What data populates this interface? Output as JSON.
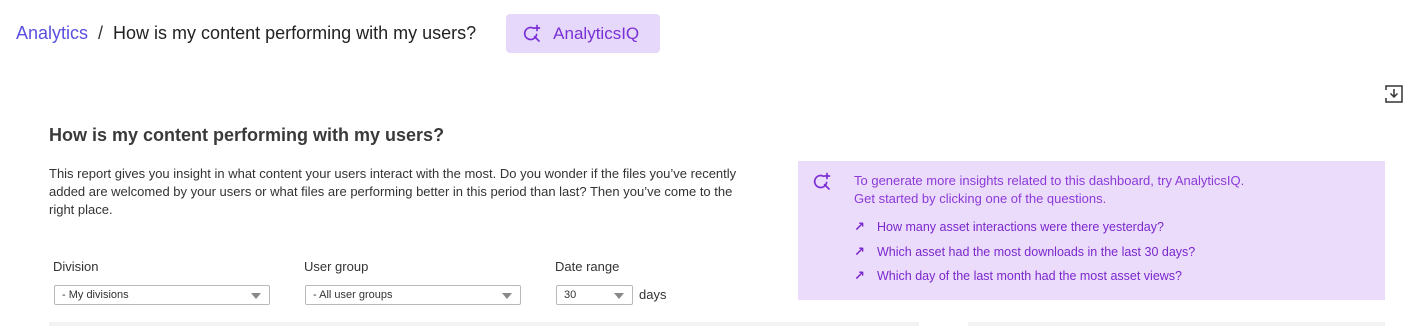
{
  "breadcrumb": {
    "root": "Analytics",
    "separator": "/",
    "current": "How is my content performing with my users?"
  },
  "analyticsiq_button": {
    "label": "AnalyticsIQ"
  },
  "report": {
    "title": "How is my content performing with my users?",
    "description": "This report gives you insight in what content your users interact with the most. Do you wonder if the files you’ve recently added are welcomed by your users or what files are performing better in this period than last? Then you’ve come to the right place."
  },
  "filters": {
    "division": {
      "label": "Division",
      "value": "- My divisions"
    },
    "user_group": {
      "label": "User group",
      "value": "- All user groups"
    },
    "date_range": {
      "label": "Date range",
      "value": "30",
      "unit": "days"
    }
  },
  "insights": {
    "intro_line1": "To generate more insights related to this dashboard, try AnalyticsIQ.",
    "intro_line2": "Get started by clicking one of the questions.",
    "questions": [
      "How many asset interactions were there yesterday?",
      "Which asset had the most downloads in the last 30 days?",
      "Which day of the last month had the most asset views?"
    ]
  },
  "colors": {
    "link": "#5a4fe0",
    "accent_purple": "#7a2fd6",
    "iq_button_bg": "#e6d8fb",
    "insights_bg": "#ecdcfc"
  }
}
